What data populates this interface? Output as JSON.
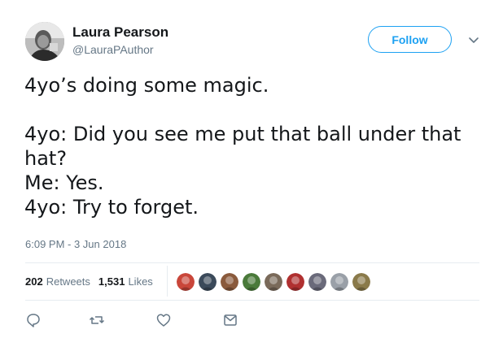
{
  "author": {
    "name": "Laura Pearson",
    "handle": "@LauraPAuthor"
  },
  "follow_label": "Follow",
  "tweet": {
    "line1": "4yo’s doing some magic.",
    "line2": "4yo: Did you see me put that ball under that hat?",
    "line3": "Me: Yes.",
    "line4": "4yo: Try to forget."
  },
  "timestamp": "6:09 PM - 3 Jun 2018",
  "stats": {
    "retweets_count": "202",
    "retweets_label": "Retweets",
    "likes_count": "1,531",
    "likes_label": "Likes"
  },
  "likers": [
    {
      "name": "liker-avatar",
      "color": "#c9463a"
    },
    {
      "name": "liker-avatar",
      "color": "#3b4a5a"
    },
    {
      "name": "liker-avatar",
      "color": "#8a5a3c"
    },
    {
      "name": "liker-avatar",
      "color": "#4a7a3a"
    },
    {
      "name": "liker-avatar",
      "color": "#7a6a5a"
    },
    {
      "name": "liker-avatar",
      "color": "#b03030"
    },
    {
      "name": "liker-avatar",
      "color": "#6a6a7a"
    },
    {
      "name": "liker-avatar",
      "color": "#9aa0a8"
    },
    {
      "name": "liker-avatar",
      "color": "#8a7a4a"
    }
  ],
  "actions": [
    "reply-icon",
    "retweet-icon",
    "like-icon",
    "direct-message-icon"
  ],
  "colors": {
    "accent": "#1da1f2",
    "text": "#14171a",
    "muted": "#657786",
    "border": "#e6ecf0"
  }
}
